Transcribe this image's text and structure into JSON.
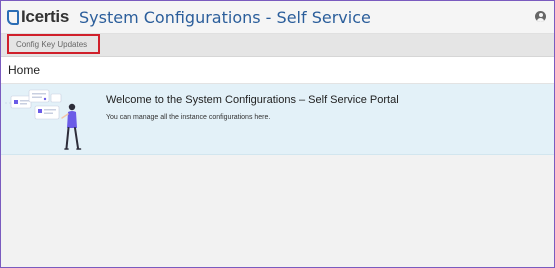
{
  "header": {
    "logo_text": "Icertis",
    "app_title": "System Configurations - Self Service"
  },
  "nav": {
    "items": [
      {
        "label": "Config Key Updates"
      }
    ]
  },
  "breadcrumb": {
    "current": "Home"
  },
  "welcome": {
    "title": "Welcome to the System Configurations – Self Service Portal",
    "subtitle": "You can manage all the instance configurations here."
  },
  "colors": {
    "accent": "#2b5e9b",
    "highlight_border": "#d0202b",
    "banner_bg": "#e3f1f8",
    "illustration_purple": "#6b5ce7"
  },
  "icons": {
    "user": "user-circle-icon",
    "logo": "icertis-logo-icon"
  }
}
